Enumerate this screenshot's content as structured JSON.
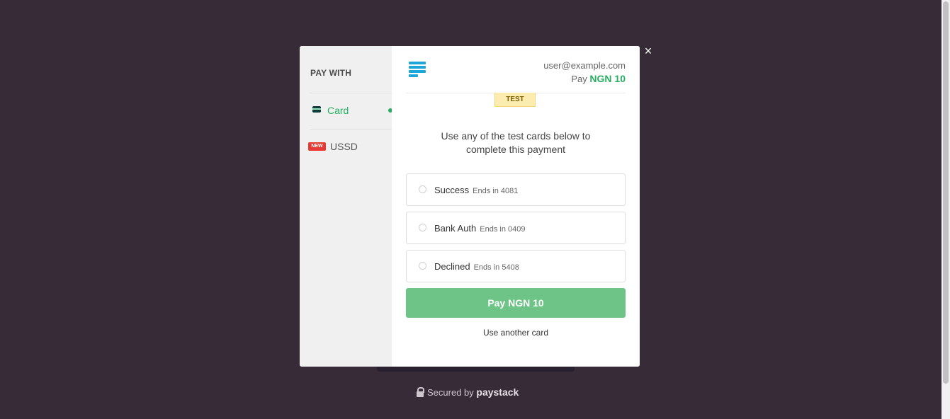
{
  "sidebar": {
    "title": "PAY WITH",
    "methods": [
      {
        "label": "Card",
        "icon": "credit-card-icon",
        "active": true
      },
      {
        "label": "USSD",
        "badge": "NEW",
        "active": false
      }
    ]
  },
  "header": {
    "email": "user@example.com",
    "pay_prefix": "Pay",
    "amount": "NGN 10",
    "logo_icon": "paystack-logo-icon"
  },
  "test_badge": "TEST",
  "instructions": "Use any of the test cards below to complete this payment",
  "cards": [
    {
      "name": "Success",
      "ends": "Ends in 4081"
    },
    {
      "name": "Bank Auth",
      "ends": "Ends in 0409"
    },
    {
      "name": "Declined",
      "ends": "Ends in 5408"
    }
  ],
  "pay_button": "Pay NGN 10",
  "another_card": "Use another card",
  "footer": {
    "secured_by": "Secured by",
    "brand": "paystack"
  },
  "colors": {
    "background": "#372b38",
    "accent_green": "#27ae60",
    "button_green": "#6ec487",
    "logo_blue": "#1fa6d8",
    "badge_red": "#e53935"
  }
}
